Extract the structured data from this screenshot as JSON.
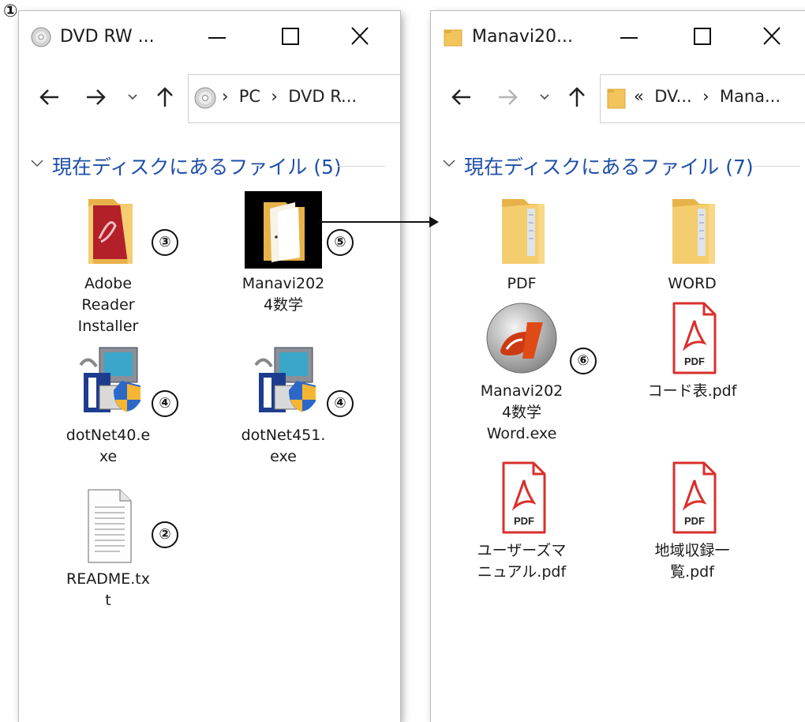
{
  "markers": {
    "m1": "①",
    "m2": "②",
    "m3": "③",
    "m4a": "④",
    "m4b": "④",
    "m5": "⑤",
    "m6": "⑥"
  },
  "left": {
    "title": "DVD RW ...",
    "crumbs": [
      "PC",
      "DVD R..."
    ],
    "group_title": "現在ディスクにあるファイル (5)",
    "items": [
      {
        "label": "Adobe\nReader\nInstaller",
        "icon": "adobe-folder-icon"
      },
      {
        "label": "Manavi202\n4数学",
        "icon": "manavi-folder-icon"
      },
      {
        "label": "dotNet40.e\nxe",
        "icon": "installer-icon"
      },
      {
        "label": "dotNet451.\nexe",
        "icon": "installer-icon"
      },
      {
        "label": "README.tx\nt",
        "icon": "text-file-icon"
      }
    ]
  },
  "right": {
    "title": "Manavi20...",
    "crumbs_prefix": "«",
    "crumbs": [
      "DV...",
      "Mana..."
    ],
    "group_title": "現在ディスクにあるファイル (7)",
    "items": [
      {
        "label": "PDF",
        "icon": "folder-icon"
      },
      {
        "label": "WORD",
        "icon": "folder-icon"
      },
      {
        "label": "Manavi202\n4数学\nWord.exe",
        "icon": "app-logo-icon"
      },
      {
        "label": "コード表.pdf",
        "icon": "pdf-icon"
      },
      {
        "label": "ユーザーズマ\nニュアル.pdf",
        "icon": "pdf-icon"
      },
      {
        "label": "地域収録一\n覧.pdf",
        "icon": "pdf-icon"
      }
    ]
  },
  "pdf_badge": "PDF",
  "colors": {
    "group_title": "#1f4fa8",
    "folder": "#f2c55c",
    "pdf_red": "#d9302c",
    "link_arrow": "#111111"
  }
}
